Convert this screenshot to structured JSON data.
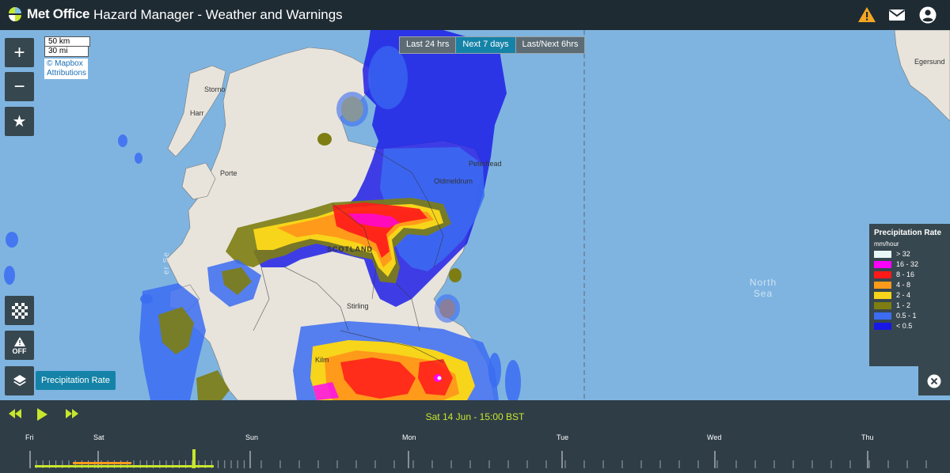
{
  "header": {
    "logo_text": "Met Office",
    "title": "Hazard Manager - Weather and Warnings",
    "icons": [
      "warning-icon",
      "mail-icon",
      "account-icon"
    ],
    "warning_color": "#f5a623"
  },
  "map": {
    "controls": {
      "zoom_in": "+",
      "zoom_out": "−",
      "favourite": "★",
      "warnings_toggle": "OFF"
    },
    "scale": {
      "km": "50 km",
      "mi": "30 mi"
    },
    "attribution": "© Mapbox Attributions",
    "time_tabs": [
      {
        "label": "Last 24 hrs",
        "active": false
      },
      {
        "label": "Next 7 days",
        "active": true
      },
      {
        "label": "Last/Next 6hrs",
        "active": false
      }
    ],
    "active_layer": "Precipitation Rate",
    "labels": {
      "north_sea": "North Sea",
      "sea_left": "er Se",
      "scotland": "SCOTLAND",
      "stirling": "Stirling",
      "oldmeldrum": "Oldmeldrum",
      "peterhead": "Peterhead",
      "kilmarnock": "Kilm",
      "storno": "Storno",
      "harris": "Harr",
      "portree": "Porte",
      "egersund": "Egersund"
    }
  },
  "legend": {
    "title": "Precipitation Rate",
    "unit": "mm/hour",
    "items": [
      {
        "label": "> 32",
        "color": "#e8f8f8"
      },
      {
        "label": "16 - 32",
        "color": "#ff00ff"
      },
      {
        "label": "8 - 16",
        "color": "#ff1a1a"
      },
      {
        "label": "4 - 8",
        "color": "#ff9a1a"
      },
      {
        "label": "2 - 4",
        "color": "#f7d51a"
      },
      {
        "label": "1 - 2",
        "color": "#7d7d12"
      },
      {
        "label": "0.5 - 1",
        "color": "#3b6cf2"
      },
      {
        "label": "< 0.5",
        "color": "#1818e6"
      }
    ]
  },
  "timeline": {
    "current": "Sat 14 Jun - 15:00 BST",
    "days": [
      "Fri",
      "Sat",
      "Sun",
      "Mon",
      "Tue",
      "Wed",
      "Thu"
    ],
    "accent": "#c7e62c"
  }
}
